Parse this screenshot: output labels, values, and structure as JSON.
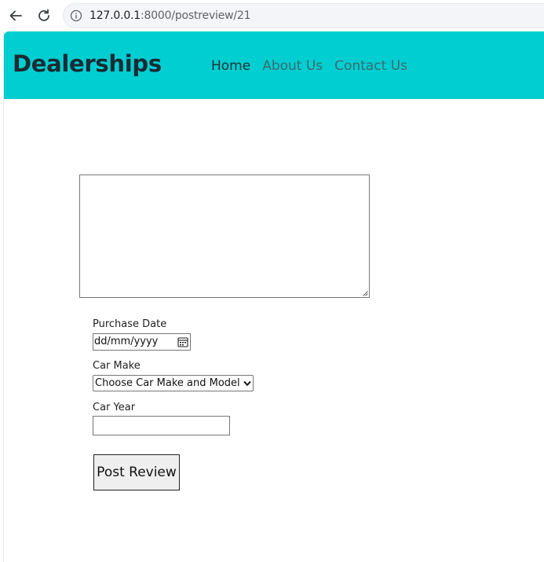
{
  "browser": {
    "url_host": "127.0.0.1",
    "url_path": ":8000/postreview/21"
  },
  "navbar": {
    "brand": "Dealerships",
    "links": [
      {
        "label": "Home",
        "active": true
      },
      {
        "label": "About Us",
        "active": false
      },
      {
        "label": "Contact Us",
        "active": false
      }
    ],
    "background": "#00ced1"
  },
  "form": {
    "review_text_value": "",
    "purchase_date_label": "Purchase Date",
    "purchase_date_placeholder": "dd/mm/yyyy",
    "car_make_label": "Car Make",
    "car_make_selected": "Choose Car Make and Model",
    "car_year_label": "Car Year",
    "car_year_value": "",
    "submit_label": "Post Review"
  }
}
